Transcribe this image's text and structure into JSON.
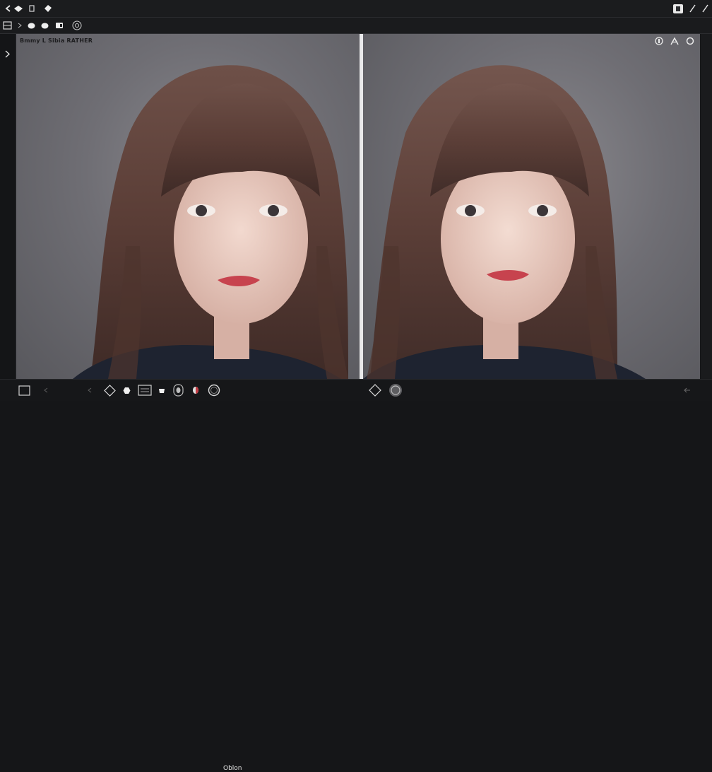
{
  "titlebar": {
    "icons": [
      "back-icon",
      "layers-icon",
      "document-icon",
      "tag-icon",
      "window-icon",
      "pen-icon"
    ]
  },
  "toolbar": {
    "icons": [
      "panel-icon",
      "arrow-icon",
      "circle-icon",
      "circle-filled-icon",
      "rectangle-icon",
      "at-icon"
    ]
  },
  "viewer": {
    "overlay_label": "Bmmy L Sibia RATHER",
    "overlay_icons": [
      "info-icon",
      "text-a-icon",
      "circle-icon"
    ]
  },
  "bottombar": {
    "label": "Oblon",
    "icons": [
      "square-icon",
      "chevron-left-icon",
      "diamond-icon",
      "hexagon-icon",
      "film-icon",
      "bucket-icon",
      "badge-icon",
      "red-dot-icon",
      "ring-icon",
      "diamond-outline-icon",
      "badge-circle-icon",
      "left-arrow-icon"
    ]
  },
  "colors": {
    "background": "#151618",
    "divider": "#e9e9ea",
    "hair": "#5a3d36",
    "skin": "#e8c9bd",
    "sweater": "#1e2330"
  }
}
